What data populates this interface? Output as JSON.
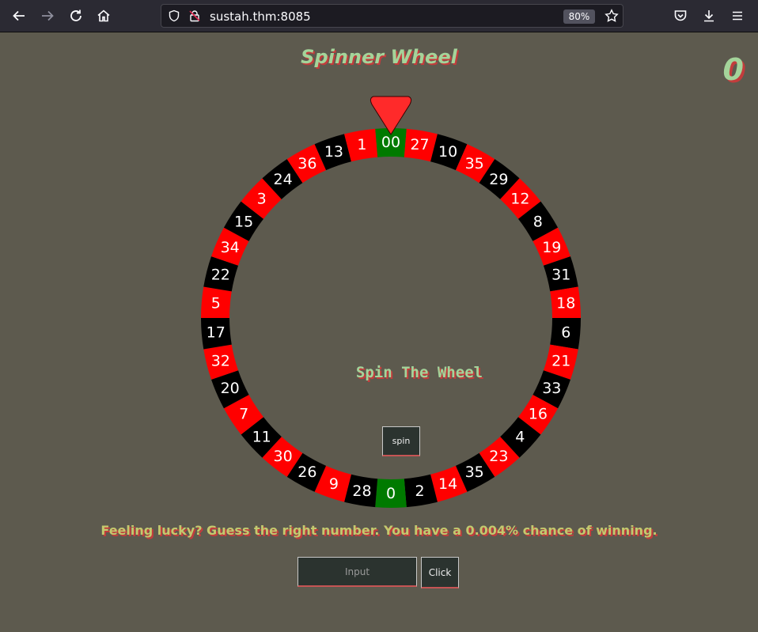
{
  "browser": {
    "url": "sustah.thm:8085",
    "zoom": "80%"
  },
  "page": {
    "title": "Spinner Wheel",
    "score": "0",
    "spin_heading": "Spin The Wheel",
    "spin_button": "spin",
    "hint": "Feeling lucky? Guess the right number. You have a 0.004% chance of winning.",
    "input_placeholder": "Input",
    "submit_button": "Click"
  },
  "wheel": {
    "colors": {
      "red": "#ff0000",
      "black": "#000000",
      "green": "#007a00",
      "pointer": "#ff2a2a"
    },
    "segments": [
      {
        "n": "00",
        "c": "green"
      },
      {
        "n": "27",
        "c": "red"
      },
      {
        "n": "10",
        "c": "black"
      },
      {
        "n": "35",
        "c": "red"
      },
      {
        "n": "29",
        "c": "black"
      },
      {
        "n": "12",
        "c": "red"
      },
      {
        "n": "8",
        "c": "black"
      },
      {
        "n": "19",
        "c": "red"
      },
      {
        "n": "31",
        "c": "black"
      },
      {
        "n": "18",
        "c": "red"
      },
      {
        "n": "6",
        "c": "black"
      },
      {
        "n": "21",
        "c": "red"
      },
      {
        "n": "33",
        "c": "black"
      },
      {
        "n": "16",
        "c": "red"
      },
      {
        "n": "4",
        "c": "black"
      },
      {
        "n": "23",
        "c": "red"
      },
      {
        "n": "35",
        "c": "black"
      },
      {
        "n": "14",
        "c": "red"
      },
      {
        "n": "2",
        "c": "black"
      },
      {
        "n": "0",
        "c": "green"
      },
      {
        "n": "28",
        "c": "black"
      },
      {
        "n": "9",
        "c": "red"
      },
      {
        "n": "26",
        "c": "black"
      },
      {
        "n": "30",
        "c": "red"
      },
      {
        "n": "11",
        "c": "black"
      },
      {
        "n": "7",
        "c": "red"
      },
      {
        "n": "20",
        "c": "black"
      },
      {
        "n": "32",
        "c": "red"
      },
      {
        "n": "17",
        "c": "black"
      },
      {
        "n": "5",
        "c": "red"
      },
      {
        "n": "22",
        "c": "black"
      },
      {
        "n": "34",
        "c": "red"
      },
      {
        "n": "15",
        "c": "black"
      },
      {
        "n": "3",
        "c": "red"
      },
      {
        "n": "24",
        "c": "black"
      },
      {
        "n": "36",
        "c": "red"
      },
      {
        "n": "13",
        "c": "black"
      },
      {
        "n": "1",
        "c": "red"
      }
    ]
  }
}
